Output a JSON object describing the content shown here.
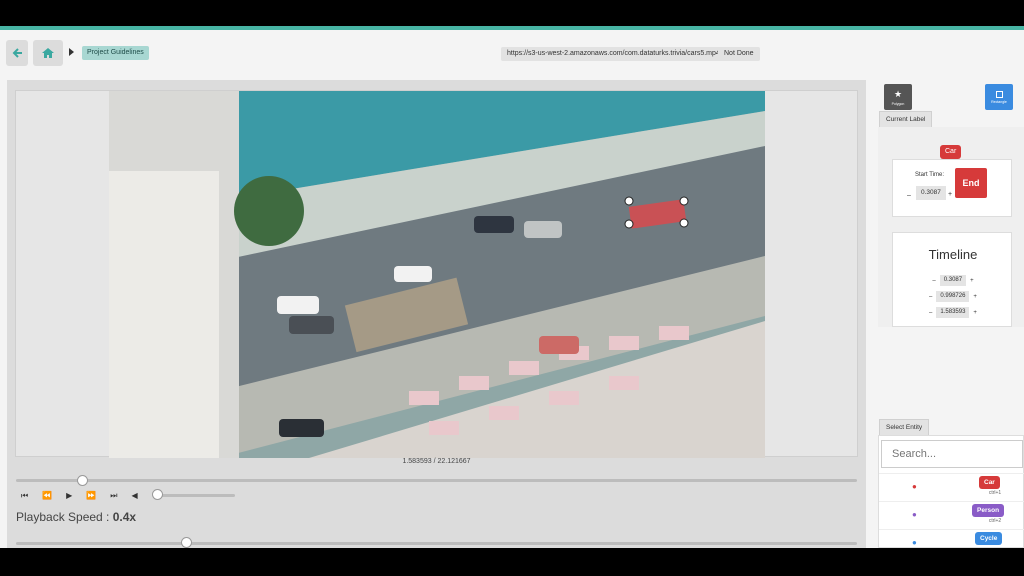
{
  "colors": {
    "accent": "#48b5a4",
    "car": "#d63a3a",
    "person": "#8a5cc7",
    "cycle": "#3a8be0"
  },
  "topbar": {
    "back_icon": "arrow-left-icon",
    "home_icon": "home-icon",
    "guidelines_label": "Project Guidelines",
    "video_url": "https://s3-us-west-2.amazonaws.com/com.dataturks.trivia/cars5.mp4",
    "status": "Not Done"
  },
  "player": {
    "timecode": "1.583593 / 22.121667",
    "progress_fraction": 0.0716,
    "controls": [
      "skip-start-icon",
      "rewind-icon",
      "play-icon",
      "fast-forward-icon",
      "skip-end-icon",
      "volume-icon"
    ],
    "volume_fraction": 0,
    "speed_label": "Playback Speed :",
    "speed_value": "0.4x",
    "speed_fraction": 0.2
  },
  "tools": {
    "polygon_label": "Polygon",
    "rectangle_label": "Rectangle"
  },
  "current_label": {
    "tab": "Current Label",
    "label": "Car",
    "start_time_label": "Start Time:",
    "start_time_value": "0.3087",
    "end_button": "End",
    "timeline_title": "Timeline",
    "timeline_values": [
      "0.3087",
      "0.998726",
      "1.583593"
    ]
  },
  "entities": {
    "tab": "Select Entity",
    "search_placeholder": "Search...",
    "items": [
      {
        "label": "Car",
        "shortcut": "ctrl+1"
      },
      {
        "label": "Person",
        "shortcut": "ctrl+2"
      },
      {
        "label": "Cycle",
        "shortcut": ""
      }
    ]
  }
}
